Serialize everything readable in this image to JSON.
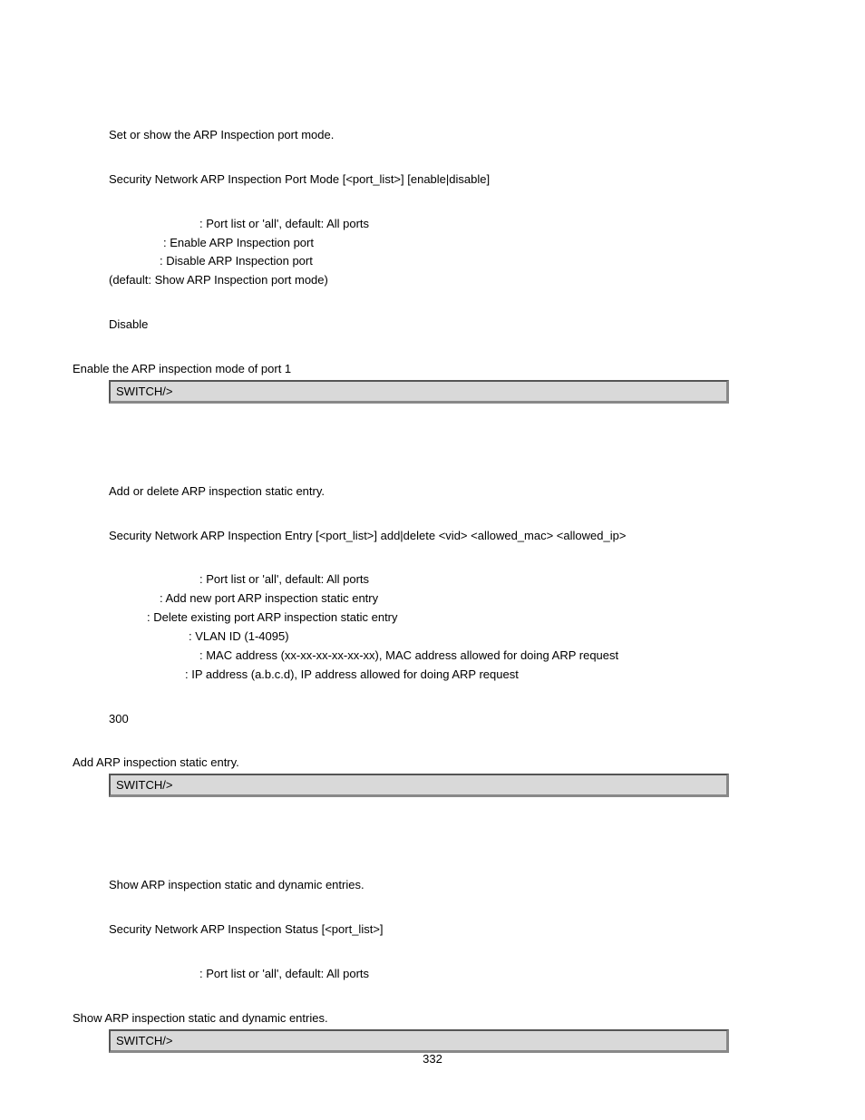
{
  "sec1": {
    "desc": "Set or show the ARP Inspection port mode.",
    "syntax": "Security Network ARP Inspection Port Mode [<port_list>] [enable|disable]",
    "params": [
      ": Port list or 'all', default: All ports",
      ": Enable ARP Inspection port",
      ": Disable ARP Inspection port",
      "(default: Show ARP Inspection port mode)"
    ],
    "default": "Disable",
    "example_lead": "Enable the ARP inspection mode of port 1",
    "terminal": "SWITCH/>"
  },
  "sec2": {
    "desc": "Add or delete ARP inspection static entry.",
    "syntax": "Security Network ARP Inspection Entry [<port_list>] add|delete <vid> <allowed_mac> <allowed_ip>",
    "params": [
      ": Port list or 'all', default: All ports",
      ": Add new port ARP inspection static entry",
      ": Delete existing port ARP inspection static entry",
      ": VLAN ID (1-4095)",
      ": MAC address (xx-xx-xx-xx-xx-xx), MAC address allowed for doing ARP request",
      ": IP address (a.b.c.d), IP address allowed for doing ARP request"
    ],
    "default": "300",
    "example_lead": "Add ARP inspection static entry.",
    "terminal": "SWITCH/>"
  },
  "sec3": {
    "desc": "Show ARP inspection static and dynamic entries.",
    "syntax": "Security Network ARP Inspection Status [<port_list>]",
    "params": [
      ": Port list or 'all', default: All ports"
    ],
    "example_lead": "Show ARP inspection static and dynamic entries.",
    "terminal": "SWITCH/>"
  },
  "pagenum": "332",
  "param_indents": {
    "sec1": [
      100,
      60,
      56,
      0
    ],
    "sec2": [
      100,
      56,
      42,
      88,
      100,
      84
    ],
    "sec3": [
      100
    ]
  }
}
